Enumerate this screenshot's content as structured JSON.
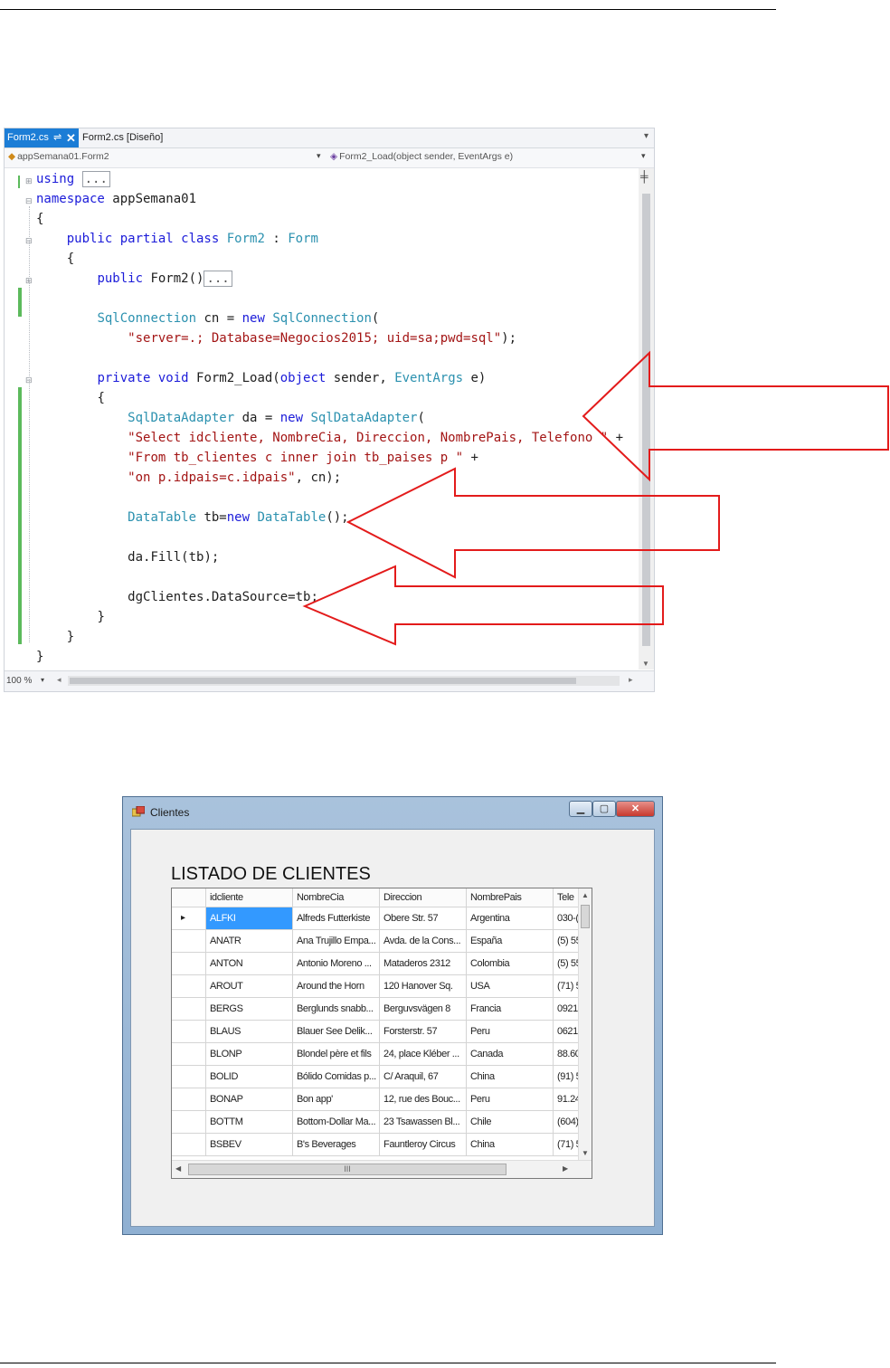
{
  "editor": {
    "tabs": [
      {
        "label": "Form2.cs",
        "active": true,
        "pin": "⇌",
        "close": "✕"
      },
      {
        "label": "Form2.cs [Diseño]",
        "active": false
      }
    ],
    "nav_left": "appSemana01.Form2",
    "nav_right": "Form2_Load(object sender, EventArgs e)",
    "zoom": "100 %",
    "lines": {
      "l1a": "using",
      "l1b": "...",
      "l2a": "namespace",
      "l2b": " appSemana01",
      "l3": "{",
      "l4a": "public partial class",
      "l4b": " ",
      "l4c": "Form2",
      "l4d": " : ",
      "l4e": "Form",
      "l5": "{",
      "l6a": "public",
      "l6b": " Form2()",
      "l6c": "...",
      "l7a": "SqlConnection",
      "l7b": " cn = ",
      "l7c": "new",
      "l7d": " ",
      "l7e": "SqlConnection",
      "l7f": "(",
      "l8a": "\"server=.; Database=Negocios2015; uid=sa;pwd=sql\"",
      "l8b": ");",
      "l9a": "private void",
      "l9b": " Form2_Load(",
      "l9c": "object",
      "l9d": " sender, ",
      "l9e": "EventArgs",
      "l9f": " e)",
      "l10": "{",
      "l11a": "SqlDataAdapter",
      "l11b": " da = ",
      "l11c": "new",
      "l11d": " ",
      "l11e": "SqlDataAdapter",
      "l11f": "(",
      "l12a": "\"Select idcliente, NombreCia, Direccion, NombrePais, Telefono \"",
      "l12b": " +",
      "l13a": "\"From tb_clientes c inner join tb_paises p \"",
      "l13b": " +",
      "l14a": "\"on p.idpais=c.idpais\"",
      "l14b": ", cn);",
      "l15a": "DataTable",
      "l15b": " tb=",
      "l15c": "new",
      "l15d": " ",
      "l15e": "DataTable",
      "l15f": "();",
      "l16": "da.Fill(tb);",
      "l17": "dgClientes.DataSource=tb;",
      "l18": "}",
      "l19": "}",
      "l20": "}"
    }
  },
  "form": {
    "title": "Clientes",
    "heading": "LISTADO DE CLIENTES",
    "columns": [
      "idcliente",
      "NombreCia",
      "Direccion",
      "NombrePais",
      "Tele"
    ],
    "rows": [
      [
        "ALFKI",
        "Alfreds Futterkiste",
        "Obere Str. 57",
        "Argentina",
        "030-("
      ],
      [
        "ANATR",
        "Ana Trujillo Empa...",
        "Avda. de la Cons...",
        "España",
        "(5) 55"
      ],
      [
        "ANTON",
        "Antonio Moreno ...",
        "Mataderos  2312",
        "Colombia",
        "(5) 55"
      ],
      [
        "AROUT",
        "Around the Horn",
        "120 Hanover Sq.",
        "USA",
        "(71) 5"
      ],
      [
        "BERGS",
        "Berglunds snabb...",
        "Berguvsvägen  8",
        "Francia",
        "0921-"
      ],
      [
        "BLAUS",
        "Blauer See Delik...",
        "Forsterstr. 57",
        "Peru",
        "0621-"
      ],
      [
        "BLONP",
        "Blondel père et fils",
        "24, place Kléber ...",
        "Canada",
        "88.60"
      ],
      [
        "BOLID",
        "Bólido Comidas p...",
        "C/ Araquil, 67",
        "China",
        "(91) 5"
      ],
      [
        "BONAP",
        "Bon app'",
        "12, rue des Bouc...",
        "Peru",
        "91.24"
      ],
      [
        "BOTTM",
        "Bottom-Dollar Ma...",
        "23 Tsawassen Bl...",
        "Chile",
        "(604)"
      ],
      [
        "BSBEV",
        "B's Beverages",
        "Fauntleroy Circus",
        "China",
        "(71) 5"
      ]
    ],
    "current_row_marker": "▸",
    "hscroll_grip": "III"
  },
  "colors": {
    "keyword": "#1b1bd9",
    "type": "#2b91af",
    "string": "#a31515",
    "arrow": "#e31b1b",
    "tab_active": "#1c7dd6",
    "selection": "#3399ff",
    "changed_marker": "#5cba5c"
  }
}
